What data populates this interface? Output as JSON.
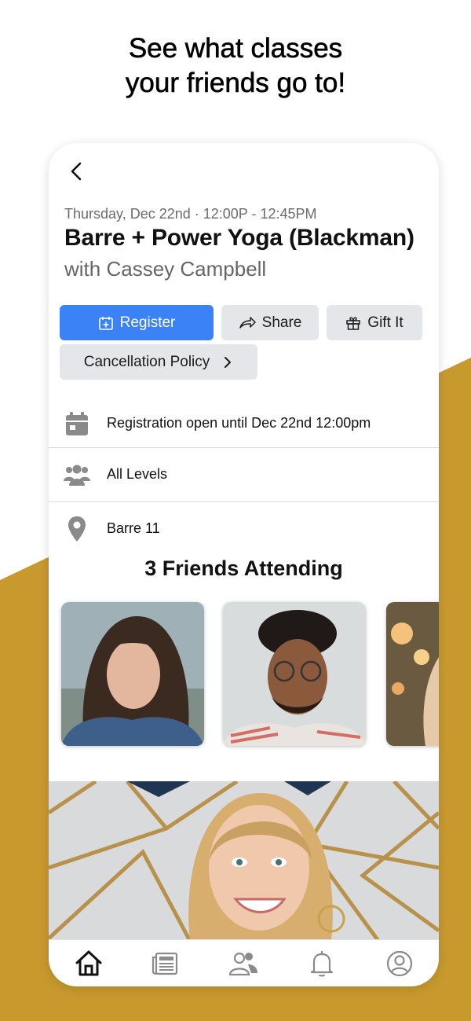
{
  "promo": {
    "headline_line1": "See what classes",
    "headline_line2": "your friends go to!",
    "accent_color": "#c89a2e"
  },
  "class_detail": {
    "datetime": "Thursday, Dec 22nd · 12:00P - 12:45PM",
    "title": "Barre + Power Yoga (Blackman)",
    "instructor_line": "with Cassey Campbell",
    "actions": {
      "register": "Register",
      "share": "Share",
      "gift": "Gift It",
      "cancellation_policy": "Cancellation Policy"
    },
    "info": {
      "registration": "Registration open until Dec 22nd 12:00pm",
      "level": "All Levels",
      "location": "Barre 11"
    },
    "friends_title": "3 Friends Attending",
    "primary_color": "#3b82f6"
  },
  "icons": {
    "back": "chevron-left-icon",
    "register": "calendar-plus-icon",
    "share": "share-arrow-icon",
    "gift": "gift-icon",
    "cancel": "chevron-right-icon",
    "registration": "calendar-icon",
    "level": "users-icon",
    "location": "map-pin-icon"
  },
  "tabbar": [
    "home-icon",
    "news-icon",
    "friends-icon",
    "notifications-icon",
    "profile-icon"
  ]
}
